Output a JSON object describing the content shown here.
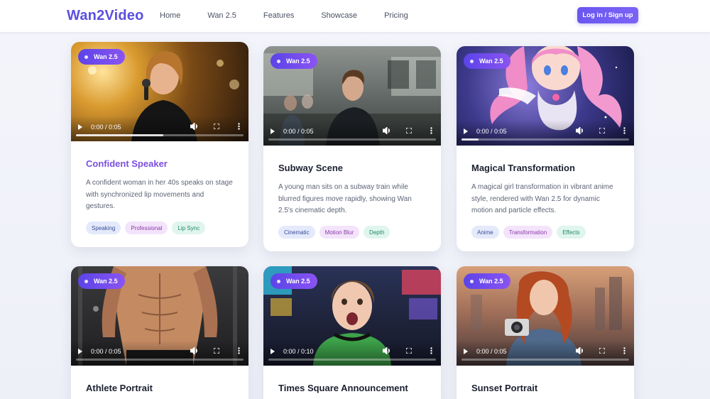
{
  "header": {
    "logo": "Wan2Video",
    "nav": [
      "Home",
      "Wan 2.5",
      "Features",
      "Showcase",
      "Pricing"
    ],
    "login_label": "Log in / Sign up"
  },
  "cards": [
    {
      "badge": "Wan 2.5",
      "time": "0:00 / 0:05",
      "progress": 0.52,
      "title": "Confident Speaker",
      "description": "A confident woman in her 40s speaks on stage with synchronized lip movements and gestures.",
      "tags": [
        "Speaking",
        "Professional",
        "Lip Sync"
      ]
    },
    {
      "badge": "Wan 2.5",
      "time": "0:00 / 0:05",
      "progress": 0.0,
      "title": "Subway Scene",
      "description": "A young man sits on a subway train while blurred figures move rapidly, showing Wan 2.5's cinematic depth.",
      "tags": [
        "Cinematic",
        "Motion Blur",
        "Depth"
      ]
    },
    {
      "badge": "Wan 2.5",
      "time": "0:00 / 0:05",
      "progress": 0.1,
      "title": "Magical Transformation",
      "description": "A magical girl transformation in vibrant anime style, rendered with Wan 2.5 for dynamic motion and particle effects.",
      "tags": [
        "Anime",
        "Transformation",
        "Effects"
      ]
    },
    {
      "badge": "Wan 2.5",
      "time": "0:00 / 0:05",
      "progress": 0.0,
      "title": "Athlete Portrait"
    },
    {
      "badge": "Wan 2.5",
      "time": "0:00 / 0:10",
      "progress": 0.0,
      "title": "Times Square Announcement"
    },
    {
      "badge": "Wan 2.5",
      "time": "0:00 / 0:05",
      "progress": 0.0,
      "title": "Sunset Portrait"
    }
  ],
  "colors": {
    "brand": "#5b4fe0",
    "accent_title": "#7b4fe0",
    "tag_blue": "#e4e9fb",
    "tag_purple": "#f3e3fb",
    "tag_green": "#dff5ee"
  }
}
